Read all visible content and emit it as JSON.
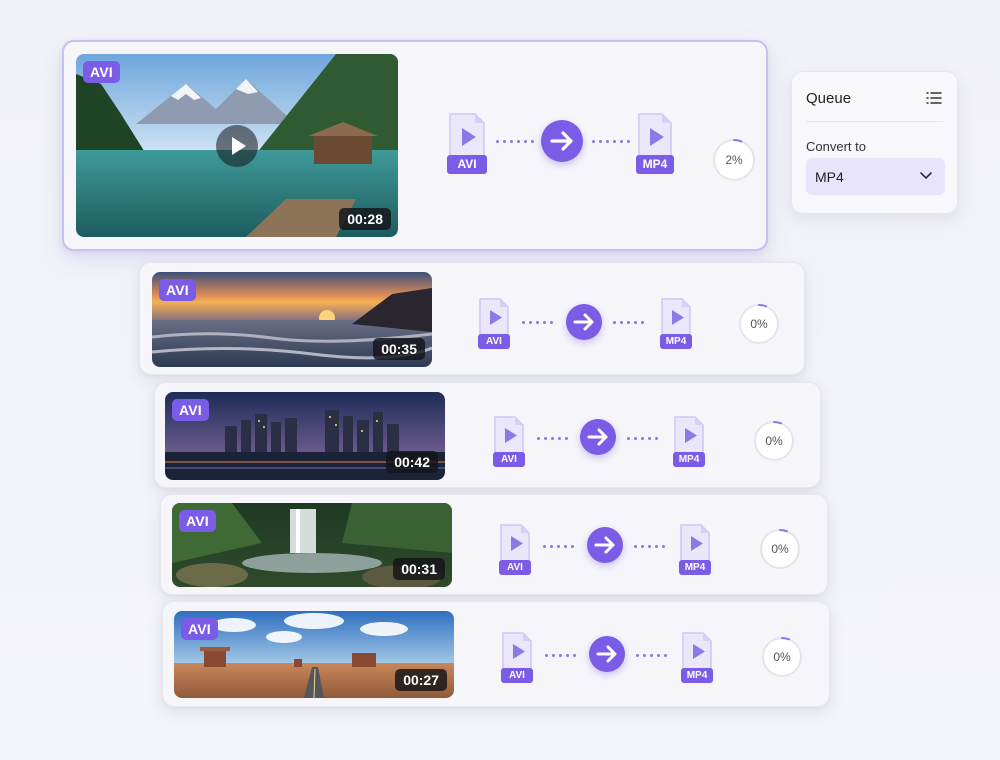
{
  "queue": {
    "title": "Queue",
    "list_icon": "list-icon",
    "convert_to_label": "Convert to",
    "selected_format": "MP4",
    "dropdown_icon": "chevron-down-icon"
  },
  "colors": {
    "accent": "#7b5ce6",
    "active_border": "#c9bff0",
    "progress_track": "#e4e4ec"
  },
  "conversions": [
    {
      "scene": "mountain-lake",
      "source_format": "AVI",
      "duration": "00:28",
      "from_label": "AVI",
      "to_label": "MP4",
      "progress_text": "2%",
      "progress": 0.02,
      "active": true,
      "has_play_button": true
    },
    {
      "scene": "sunset-beach",
      "source_format": "AVI",
      "duration": "00:35",
      "from_label": "AVI",
      "to_label": "MP4",
      "progress_text": "0%",
      "progress": 0.0,
      "active": false,
      "has_play_button": false
    },
    {
      "scene": "city-night",
      "source_format": "AVI",
      "duration": "00:42",
      "from_label": "AVI",
      "to_label": "MP4",
      "progress_text": "0%",
      "progress": 0.0,
      "active": false,
      "has_play_button": false
    },
    {
      "scene": "waterfall-forest",
      "source_format": "AVI",
      "duration": "00:31",
      "from_label": "AVI",
      "to_label": "MP4",
      "progress_text": "0%",
      "progress": 0.0,
      "active": false,
      "has_play_button": false
    },
    {
      "scene": "desert-road",
      "source_format": "AVI",
      "duration": "00:27",
      "from_label": "AVI",
      "to_label": "MP4",
      "progress_text": "0%",
      "progress": 0.0,
      "active": false,
      "has_play_button": false
    }
  ]
}
